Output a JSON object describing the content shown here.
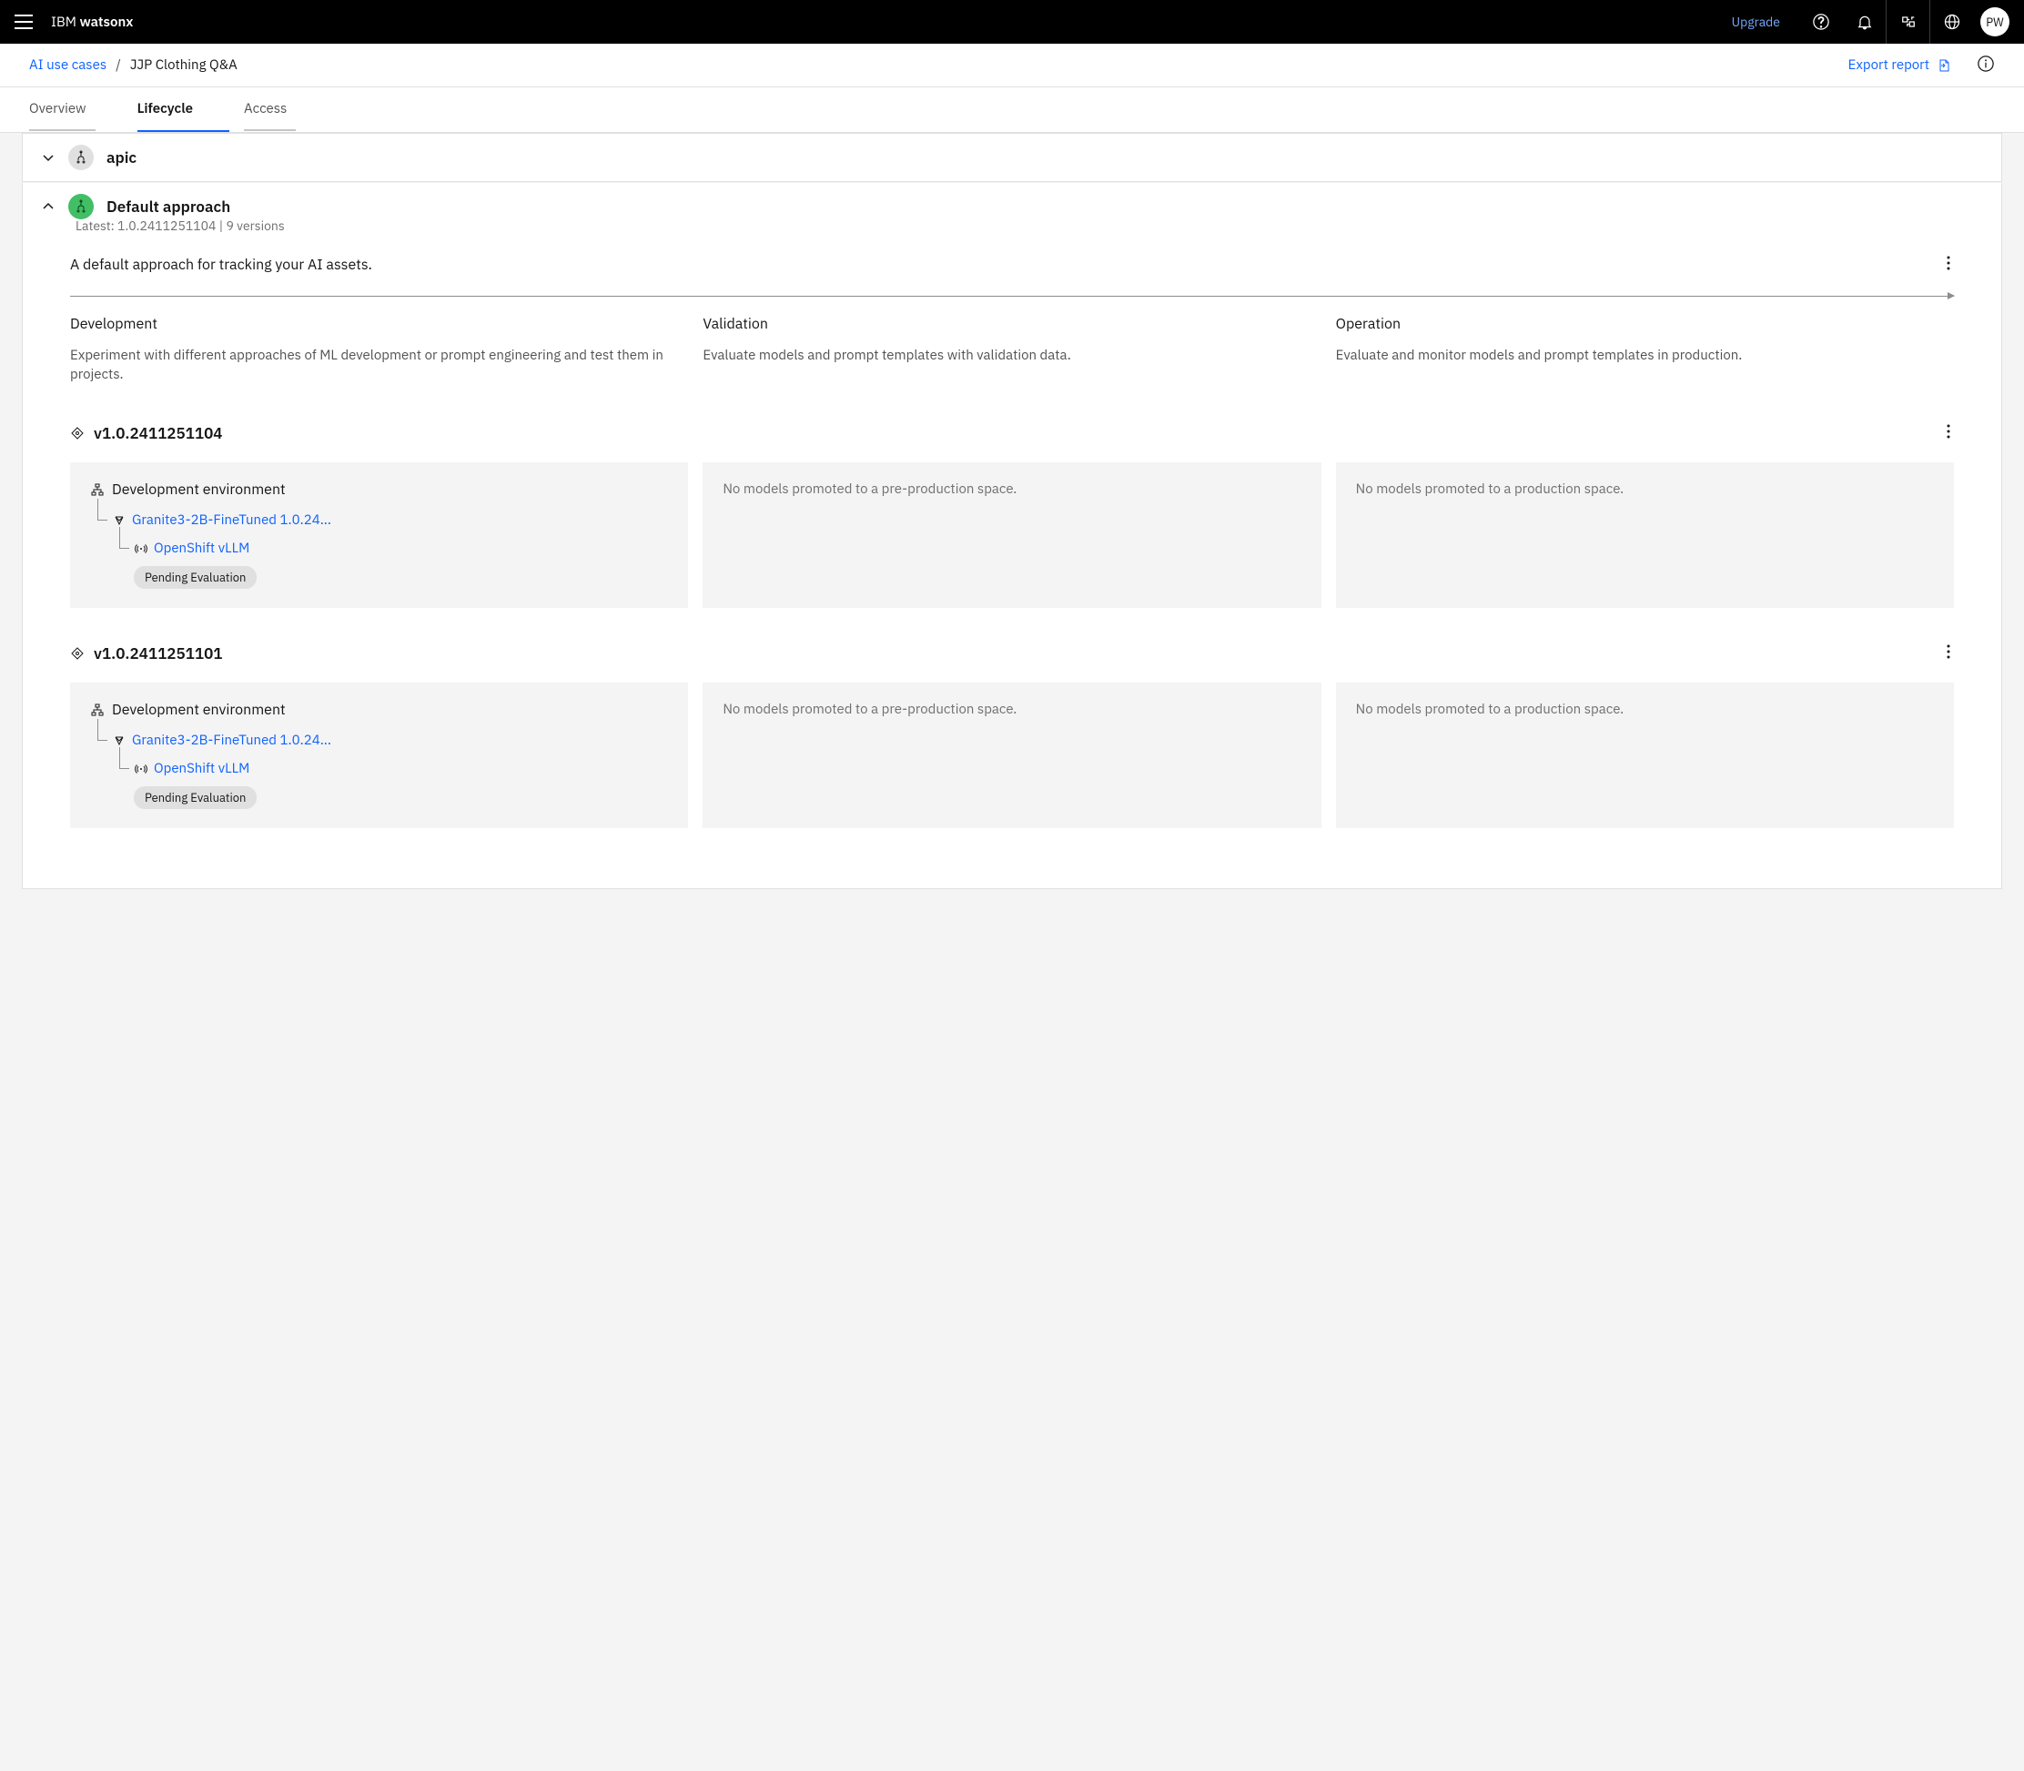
{
  "header": {
    "brand_prefix": "IBM ",
    "brand_bold": "watsonx",
    "upgrade": "Upgrade",
    "avatar": "PW"
  },
  "breadcrumb": {
    "parent": "AI use cases",
    "separator": "/",
    "current": "JJP Clothing Q&A",
    "export": "Export report"
  },
  "tabs": [
    {
      "label": "Overview",
      "active": false
    },
    {
      "label": "Lifecycle",
      "active": true
    },
    {
      "label": "Access",
      "active": false
    }
  ],
  "sections": {
    "apic": {
      "title": "apic"
    },
    "default": {
      "title": "Default approach",
      "subtitle": "Latest: 1.0.2411251104 | 9 versions",
      "description": "A default approach for tracking your AI assets.",
      "phases": [
        {
          "title": "Development",
          "desc": "Experiment with different approaches of ML development or prompt engineering and test them in projects."
        },
        {
          "title": "Validation",
          "desc": "Evaluate models and prompt templates with validation data."
        },
        {
          "title": "Operation",
          "desc": "Evaluate and monitor models and prompt templates in production."
        }
      ],
      "versions": [
        {
          "name": "v1.0.2411251104",
          "dev": {
            "env": "Development environment",
            "model": "Granite3-2B-FineTuned 1.0.24...",
            "deployment": "OpenShift vLLM",
            "status": "Pending Evaluation"
          },
          "validation_empty": "No models promoted to a pre-production space.",
          "operation_empty": "No models promoted to a production space."
        },
        {
          "name": "v1.0.2411251101",
          "dev": {
            "env": "Development environment",
            "model": "Granite3-2B-FineTuned 1.0.24...",
            "deployment": "OpenShift vLLM",
            "status": "Pending Evaluation"
          },
          "validation_empty": "No models promoted to a pre-production space.",
          "operation_empty": "No models promoted to a production space."
        }
      ]
    }
  }
}
